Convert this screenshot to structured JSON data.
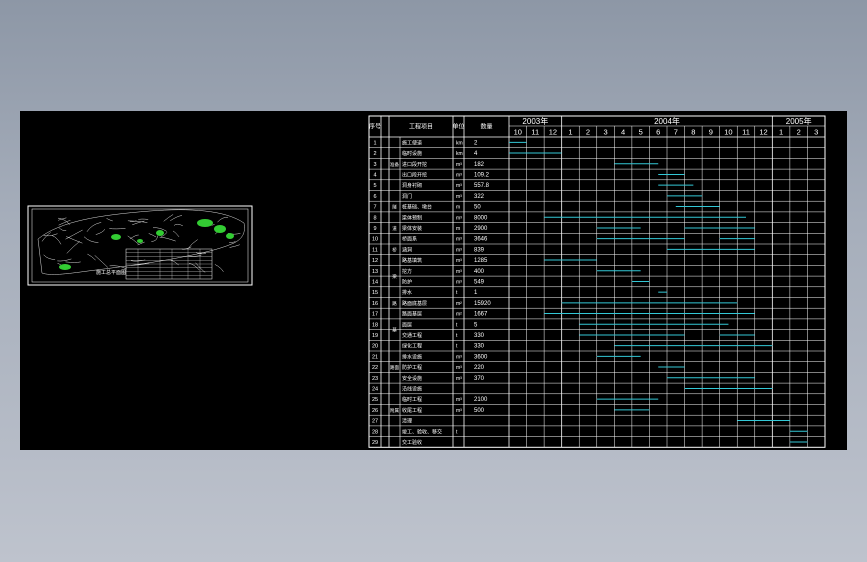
{
  "drawing": {
    "map_caption": "施工总平面图",
    "background_color": "#000000",
    "line_color": "#ffffff",
    "bar_color": "#33c8d6",
    "map_green": "#33cc33"
  },
  "schedule": {
    "header": {
      "no_label": "序号",
      "work_label": "工程项目",
      "unit_label": "单位",
      "qty_label": "数量"
    },
    "years": [
      {
        "label": "2003年",
        "months": [
          "10",
          "11",
          "12"
        ]
      },
      {
        "label": "2004年",
        "months": [
          "1",
          "2",
          "3",
          "4",
          "5",
          "6",
          "7",
          "8",
          "9",
          "10",
          "11",
          "12"
        ]
      },
      {
        "label": "2005年",
        "months": [
          "1",
          "2",
          "3"
        ]
      }
    ],
    "group_labels": [
      "准备",
      "隧",
      "道",
      "桥",
      "梁",
      "路",
      "基",
      "路面",
      "附属"
    ],
    "rows": [
      {
        "no": "1",
        "name": "施工便道",
        "unit": "km",
        "qty": "2",
        "bars": [
          [
            0,
            1
          ]
        ]
      },
      {
        "no": "2",
        "name": "临时设施",
        "unit": "km",
        "qty": "4",
        "bars": [
          [
            0,
            3
          ]
        ]
      },
      {
        "no": "3",
        "name": "进口段开挖",
        "unit": "m³",
        "qty": "182",
        "bars": [
          [
            6,
            8.5
          ]
        ]
      },
      {
        "no": "4",
        "name": "出口段开挖",
        "unit": "m³",
        "qty": "109.2",
        "bars": [
          [
            8.5,
            10
          ]
        ]
      },
      {
        "no": "5",
        "name": "洞身衬砌",
        "unit": "m³",
        "qty": "557.8",
        "bars": [
          [
            8.5,
            10.5
          ]
        ]
      },
      {
        "no": "6",
        "name": "洞门",
        "unit": "m³",
        "qty": "322",
        "bars": [
          [
            9,
            11
          ]
        ]
      },
      {
        "no": "7",
        "name": "桩基础、墩台",
        "unit": "m",
        "qty": "50",
        "bars": [
          [
            9.5,
            12
          ]
        ]
      },
      {
        "no": "8",
        "name": "梁体预制",
        "unit": "m³",
        "qty": "8000",
        "bars": [
          [
            2,
            13.5
          ]
        ]
      },
      {
        "no": "9",
        "name": "梁体安装",
        "unit": "m",
        "qty": "2900",
        "bars": [
          [
            5,
            7.5
          ],
          [
            10,
            14
          ]
        ]
      },
      {
        "no": "10",
        "name": "桥面系",
        "unit": "m³",
        "qty": "3646",
        "bars": [
          [
            5,
            10
          ],
          [
            12,
            14
          ]
        ]
      },
      {
        "no": "11",
        "name": "涵洞",
        "unit": "m³",
        "qty": "839",
        "bars": [
          [
            9,
            14
          ]
        ]
      },
      {
        "no": "12",
        "name": "路基填筑",
        "unit": "m³",
        "qty": "1285",
        "bars": [
          [
            2,
            5
          ]
        ]
      },
      {
        "no": "13",
        "name": "挖方",
        "unit": "m³",
        "qty": "400",
        "bars": [
          [
            5,
            7.5
          ]
        ]
      },
      {
        "no": "14",
        "name": "防护",
        "unit": "m³",
        "qty": "549",
        "bars": [
          [
            7,
            8
          ]
        ]
      },
      {
        "no": "15",
        "name": "排水",
        "unit": "t",
        "qty": "1",
        "bars": [
          [
            8.5,
            9
          ]
        ]
      },
      {
        "no": "16",
        "name": "路面底基层",
        "unit": "m²",
        "qty": "15920",
        "bars": [
          [
            3,
            13
          ]
        ]
      },
      {
        "no": "17",
        "name": "路面基层",
        "unit": "m²",
        "qty": "1667",
        "bars": [
          [
            2,
            14
          ]
        ]
      },
      {
        "no": "18",
        "name": "面层",
        "unit": "t",
        "qty": "5",
        "bars": [
          [
            4,
            12.5
          ]
        ]
      },
      {
        "no": "19",
        "name": "交通工程",
        "unit": "t",
        "qty": "330",
        "bars": [
          [
            4,
            10
          ],
          [
            12,
            14
          ]
        ]
      },
      {
        "no": "20",
        "name": "绿化工程",
        "unit": "t",
        "qty": "330",
        "bars": [
          [
            6,
            15
          ]
        ]
      },
      {
        "no": "21",
        "name": "排水设施",
        "unit": "m³",
        "qty": "3600",
        "bars": [
          [
            5,
            7.5
          ]
        ]
      },
      {
        "no": "22",
        "name": "防护工程",
        "unit": "m³",
        "qty": "220",
        "bars": [
          [
            8.5,
            10
          ]
        ]
      },
      {
        "no": "23",
        "name": "安全设施",
        "unit": "m³",
        "qty": "370",
        "bars": [
          [
            9,
            14
          ]
        ]
      },
      {
        "no": "24",
        "name": "沿线设施",
        "unit": "",
        "qty": "",
        "bars": [
          [
            10,
            15
          ]
        ]
      },
      {
        "no": "25",
        "name": "临时工程",
        "unit": "m³",
        "qty": "2100",
        "bars": [
          [
            5,
            8.5
          ]
        ]
      },
      {
        "no": "26",
        "name": "收尾工程",
        "unit": "m³",
        "qty": "500",
        "bars": [
          [
            6,
            8
          ]
        ]
      },
      {
        "no": "27",
        "name": "清理",
        "unit": "",
        "qty": "",
        "bars": [
          [
            13,
            16
          ]
        ]
      },
      {
        "no": "28",
        "name": "竣工、验收、移交",
        "unit": "t",
        "qty": "",
        "bars": [
          [
            16,
            17
          ]
        ]
      },
      {
        "no": "29",
        "name": "交工验收",
        "unit": "",
        "qty": "",
        "bars": [
          [
            16,
            17
          ]
        ]
      }
    ]
  }
}
